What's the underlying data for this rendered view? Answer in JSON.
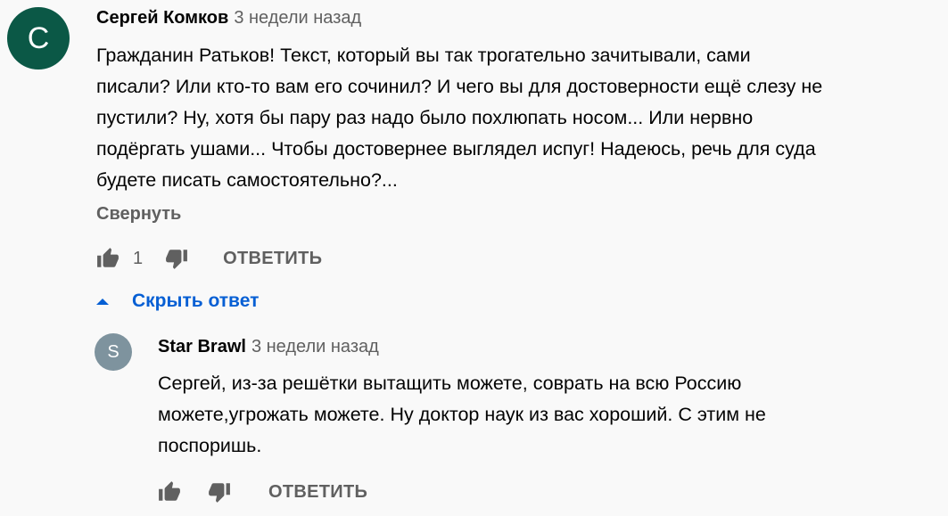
{
  "comment": {
    "avatar_letter": "С",
    "avatar_color": "#0b5846",
    "author": "Сергей Комков",
    "time": "3 недели назад",
    "lines": [
      "Гражданин Ратьков! Текст, который вы так трогательно зачитывали, сами",
      "писали? Или кто-то вам его сочинил? И чего вы для достоверности ещё слезу не",
      "пустили? Ну, хотя бы пару раз надо было похлюпать носом... Или нервно",
      "подёргать ушами... Чтобы достовернее выглядел испуг! Надеюсь, речь для суда",
      "будете писать самостоятельно?..."
    ],
    "collapse_label": "Свернуть",
    "like_count": "1",
    "reply_label": "ОТВЕТИТЬ",
    "like_icon": "thumb-up-icon",
    "dislike_icon": "thumb-down-icon"
  },
  "replies_toggle": {
    "label": "Скрыть ответ",
    "icon": "caret-up-icon"
  },
  "reply": {
    "avatar_letter": "S",
    "avatar_color": "#7e939e",
    "author": "Star Brawl",
    "time": "3 недели назад",
    "lines": [
      "Сергей, из-за решётки вытащить можете, соврать на всю Россию",
      "можете,угрожать можете. Ну доктор наук из вас хороший. С этим не",
      "поспоришь."
    ],
    "reply_label": "ОТВЕТИТЬ",
    "like_icon": "thumb-up-icon",
    "dislike_icon": "thumb-down-icon"
  },
  "colors": {
    "link_blue": "#065fd4",
    "secondary_text": "#606060",
    "icon_gray": "#606060"
  }
}
